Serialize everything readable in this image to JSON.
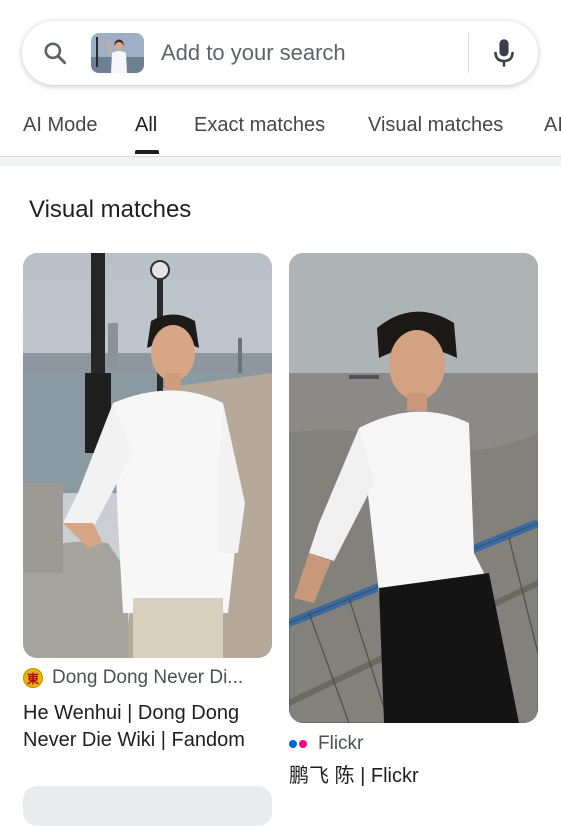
{
  "search": {
    "placeholder": "Add to your search"
  },
  "tabs": [
    {
      "label": "AI Mode"
    },
    {
      "label": "All",
      "active": true
    },
    {
      "label": "Exact matches"
    },
    {
      "label": "Visual matches"
    },
    {
      "label": "AI"
    }
  ],
  "section_title": "Visual matches",
  "results": [
    {
      "source": "Dong Dong Never Di...",
      "favicon_char": "東",
      "title": "He Wenhui | Dong Dong Never Die Wiki | Fandom"
    },
    {
      "source": "Flickr",
      "title": "鹏飞 陈 | Flickr"
    }
  ],
  "icons": {
    "search": "search-icon",
    "mic": "mic-icon"
  },
  "colors": {
    "flickr_blue": "#0063dc",
    "flickr_pink": "#ff0084",
    "google_blue": "#4285f4"
  }
}
